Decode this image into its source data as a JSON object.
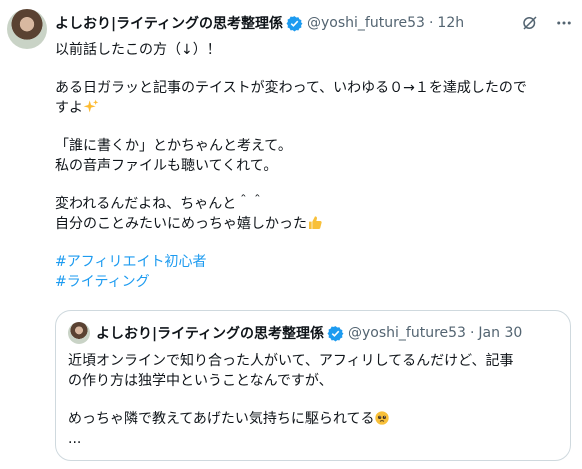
{
  "tweet": {
    "author_name": "よしおり|ライティングの思考整理係",
    "handle": "@yoshi_future53",
    "separator": "·",
    "time": "12h",
    "lines": [
      "以前話したこの方（↓）！",
      "",
      "ある日ガラッと記事のテイストが変わって、いわゆる０→１を達成したので",
      "すよ",
      "",
      "「誰に書くか」とかちゃんと考えて。",
      "私の音声ファイルも聴いてくれて。",
      "",
      "変われるんだよね、ちゃんと＾＾",
      "自分のことみたいにめっちゃ嬉しかった"
    ],
    "hashtags": [
      "#アフィリエイト初心者",
      "#ライティング"
    ]
  },
  "quoted": {
    "author_name": "よしおり|ライティングの思考整理係",
    "handle": "@yoshi_future53",
    "separator": "·",
    "time": "Jan 30",
    "lines": [
      "近頃オンラインで知り合った人がいて、アフィリしてるんだけど、記事",
      "の作り方は独学中ということなんですが、",
      "",
      "めっちゃ隣で教えてあげたい気持ちに駆られてる",
      "..."
    ]
  },
  "colors": {
    "link": "#1d9bf0",
    "verified": "#1d9bf0",
    "muted": "#536471",
    "border": "#cfd9de"
  },
  "icons": [
    "grok-icon",
    "more-icon",
    "sparkles-emoji",
    "thumbs-up-emoji",
    "pleading-face-emoji",
    "verified-badge-icon"
  ]
}
